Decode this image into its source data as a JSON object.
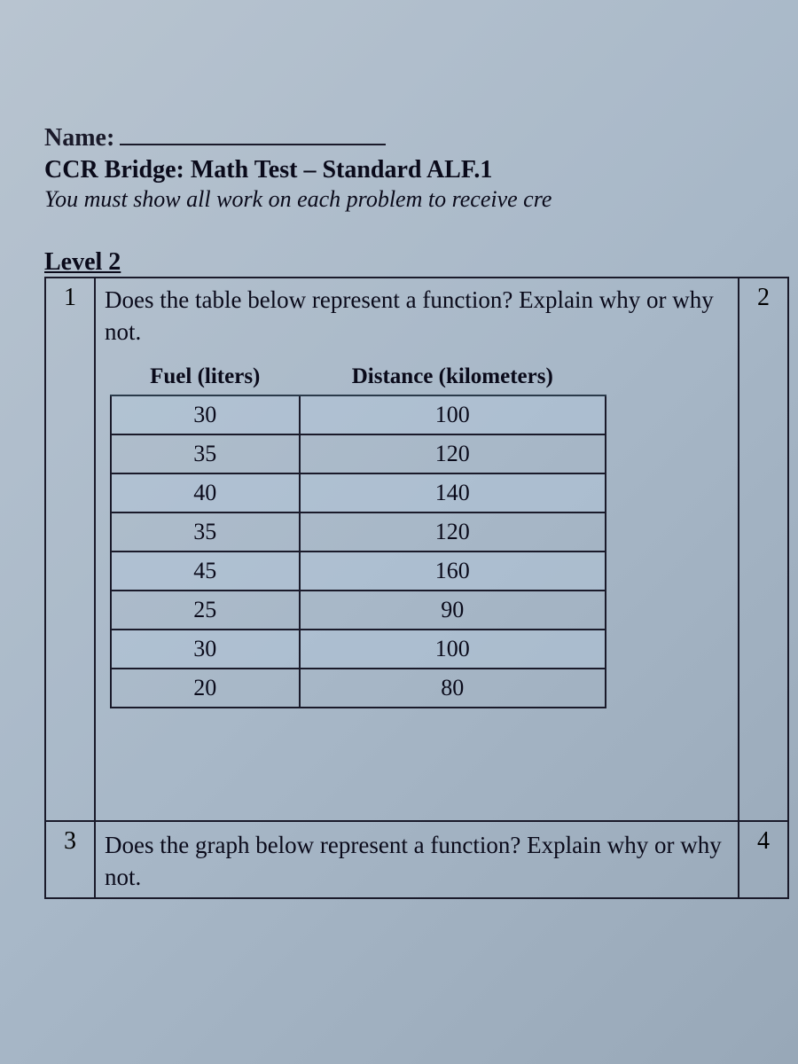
{
  "header": {
    "name_label": "Name:",
    "title": "CCR Bridge: Math Test – Standard ALF.1",
    "instruction": "You must show all work on each problem to receive cre"
  },
  "level_label": "Level 2",
  "questions": {
    "q1": {
      "number": "1",
      "text": "Does the table below represent a function? Explain why or why not.",
      "right_number": "2"
    },
    "q3": {
      "number": "3",
      "text": "Does the graph below represent a function? Explain why or why not.",
      "right_number": "4"
    }
  },
  "chart_data": {
    "type": "table",
    "headers": [
      "Fuel (liters)",
      "Distance (kilometers)"
    ],
    "rows": [
      [
        30,
        100
      ],
      [
        35,
        120
      ],
      [
        40,
        140
      ],
      [
        35,
        120
      ],
      [
        45,
        160
      ],
      [
        25,
        90
      ],
      [
        30,
        100
      ],
      [
        20,
        80
      ]
    ]
  }
}
